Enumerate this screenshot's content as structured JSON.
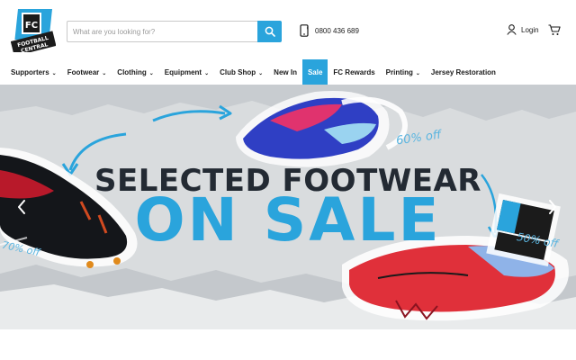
{
  "brand": {
    "name_line1": "FOOTBALL",
    "name_line2": "CENTRAL",
    "monogram": "FC"
  },
  "search": {
    "placeholder": "What are you looking for?",
    "icon": "search-icon"
  },
  "phone": {
    "icon": "phone-icon",
    "number": "0800 436 689"
  },
  "account": {
    "login_label": "Login",
    "icon": "user-icon",
    "cart_icon": "cart-icon"
  },
  "nav": {
    "items": [
      {
        "label": "Supporters",
        "has_dropdown": true
      },
      {
        "label": "Footwear",
        "has_dropdown": true
      },
      {
        "label": "Clothing",
        "has_dropdown": true
      },
      {
        "label": "Equipment",
        "has_dropdown": true
      },
      {
        "label": "Club Shop",
        "has_dropdown": true
      },
      {
        "label": "New In",
        "has_dropdown": false
      },
      {
        "label": "Sale",
        "has_dropdown": false,
        "active": true
      },
      {
        "label": "FC Rewards",
        "has_dropdown": false
      },
      {
        "label": "Printing",
        "has_dropdown": true
      },
      {
        "label": "Jersey Restoration",
        "has_dropdown": false
      }
    ],
    "chevron": "⌄"
  },
  "hero": {
    "headline_line1": "SELECTED FOOTWEAR",
    "headline_line2": "ON SALE",
    "discount_tags": [
      "60% off",
      "70% off",
      "50% off"
    ],
    "prev_icon": "chevron-left-icon",
    "next_icon": "chevron-right-icon"
  },
  "colors": {
    "accent": "#2aa4dc",
    "dark": "#232a33",
    "hero_bg": "#dcdfe1"
  }
}
